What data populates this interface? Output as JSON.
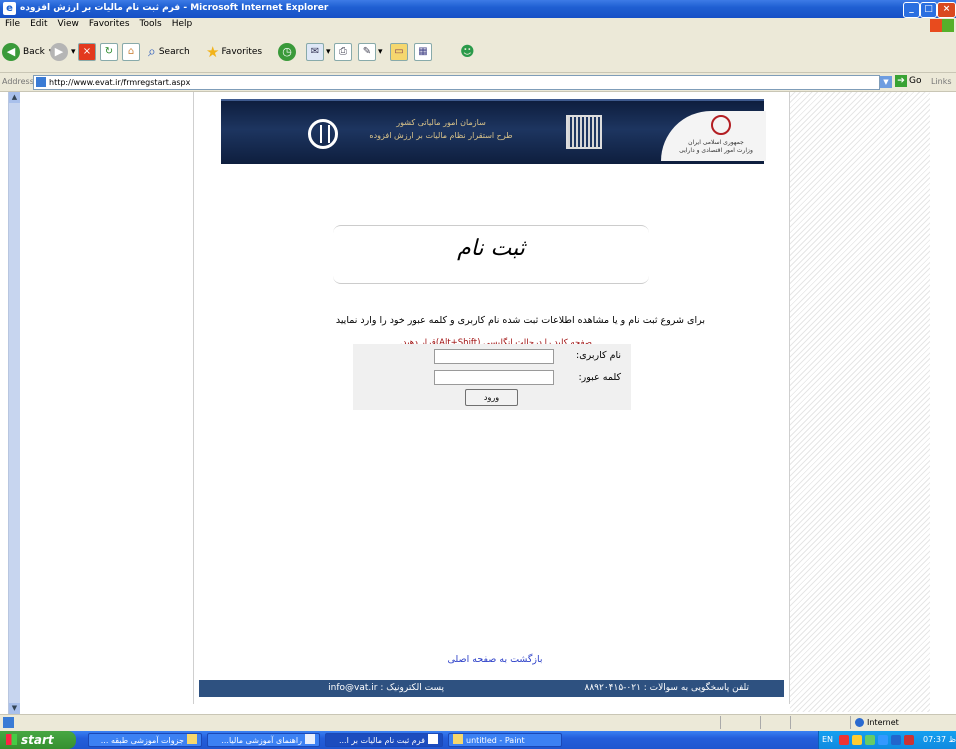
{
  "window": {
    "title": "فرم ثبت نام مالیات بر ارزش افزوده - Microsoft Internet Explorer",
    "controls": [
      "_",
      "□",
      "×"
    ]
  },
  "menu": [
    "File",
    "Edit",
    "View",
    "Favorites",
    "Tools",
    "Help"
  ],
  "toolbar": {
    "back": "Back",
    "search": "Search",
    "favorites": "Favorites"
  },
  "address": {
    "label": "Address",
    "url": "http://www.evat.ir/frmregstart.aspx",
    "go": "Go",
    "links": "Links"
  },
  "banner": {
    "line1": "سازمان امور مالیاتی کشور",
    "line2": "طرح استقرار نظام مالیات بر ارزش افزوده",
    "gov1": "جمهوری اسلامی ایران",
    "gov2": "وزارت امور اقتصادی و دارایی"
  },
  "page": {
    "heading": "ثبت نام",
    "instruction": "برای شروع ثبت نام و یا مشاهده اطلاعات ثبت شده نام کاربری و کلمه عبور خود را وارد نمایید",
    "keyboard_note": "صفحه کلید را درحالت انگلیسی (Alt+Shift)قرار دهید.",
    "username_label": "نام کاربری:",
    "password_label": "کلمه عبور:",
    "username_value": "",
    "password_value": "",
    "login_button": "ورود",
    "back_link": "بازگشت به صفحه اصلی",
    "footer_phone": "تلفن پاسخگویی به سوالات : ۰۲۱-۸۸۹۲۰۴۱۵",
    "footer_email": "پست الکترونیک : info@vat.ir"
  },
  "status": {
    "zone": "Internet"
  },
  "taskbar": {
    "start": "start",
    "tasks": [
      "جزوات آموزشی طبقه ...",
      "راهنمای آموزشی مالیا...",
      "فرم ثبت نام مالیات بر ا...",
      "untitled - Paint"
    ],
    "lang": "EN",
    "clock": "07:37 ق.ظ"
  },
  "colors": {
    "titlebar": "#1f5fd2",
    "footer": "#2e5180",
    "keyboard_note": "#a01010",
    "back_link": "#2b3fc8"
  }
}
